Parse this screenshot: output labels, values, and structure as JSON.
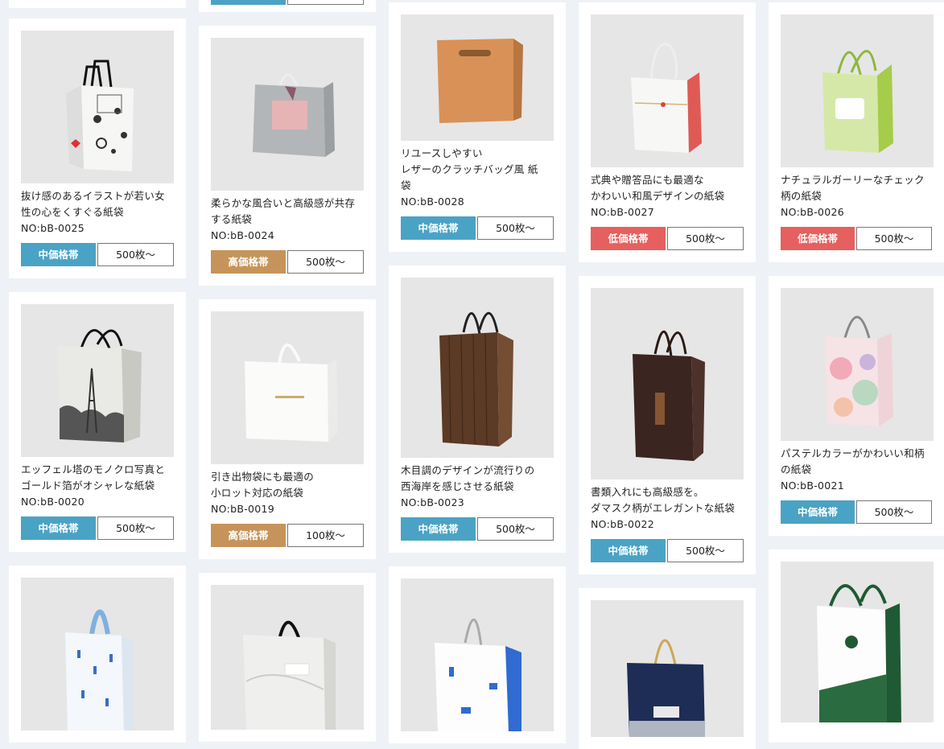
{
  "colors": {
    "mid": "#4aa3c4",
    "high": "#c6945a",
    "low": "#e5605f"
  },
  "products": [
    {
      "desc": [
        "抜け感のあるイラストが若い女",
        "性の心をくすぐる紙袋"
      ],
      "no": "NO:bB-0025",
      "price": "中価格帯",
      "qty": "500枚〜"
    },
    {
      "desc": [
        "柔らかな風合いと高級感が共存",
        "する紙袋"
      ],
      "no": "NO:bB-0024",
      "price": "高価格帯",
      "qty": "500枚〜"
    },
    {
      "desc": [
        "リユースしやすい",
        "レザーのクラッチバッグ風 紙",
        "袋"
      ],
      "no": "NO:bB-0028",
      "price": "中価格帯",
      "qty": "500枚〜"
    },
    {
      "desc": [
        "式典や贈答品にも最適な",
        "かわいい和風デザインの紙袋"
      ],
      "no": "NO:bB-0027",
      "price": "低価格帯",
      "qty": "500枚〜"
    },
    {
      "desc": [
        "ナチュラルガーリーなチェック",
        "柄の紙袋"
      ],
      "no": "NO:bB-0026",
      "price": "低価格帯",
      "qty": "500枚〜"
    },
    {
      "desc": [
        "エッフェル塔のモノクロ写真と",
        "ゴールド箔がオシャレな紙袋"
      ],
      "no": "NO:bB-0020",
      "price": "中価格帯",
      "qty": "500枚〜"
    },
    {
      "desc": [
        "引き出物袋にも最適の",
        "小ロット対応の紙袋"
      ],
      "no": "NO:bB-0019",
      "price": "高価格帯",
      "qty": "100枚〜"
    },
    {
      "desc": [
        "木目調のデザインが流行りの",
        "西海岸を感じさせる紙袋"
      ],
      "no": "NO:bB-0023",
      "price": "中価格帯",
      "qty": "500枚〜"
    },
    {
      "desc": [
        "書類入れにも高級感を。",
        "ダマスク柄がエレガントな紙袋"
      ],
      "no": "NO:bB-0022",
      "price": "中価格帯",
      "qty": "500枚〜"
    },
    {
      "desc": [
        "パステルカラーがかわいい和柄",
        "の紙袋"
      ],
      "no": "NO:bB-0021",
      "price": "中価格帯",
      "qty": "500枚〜"
    }
  ]
}
